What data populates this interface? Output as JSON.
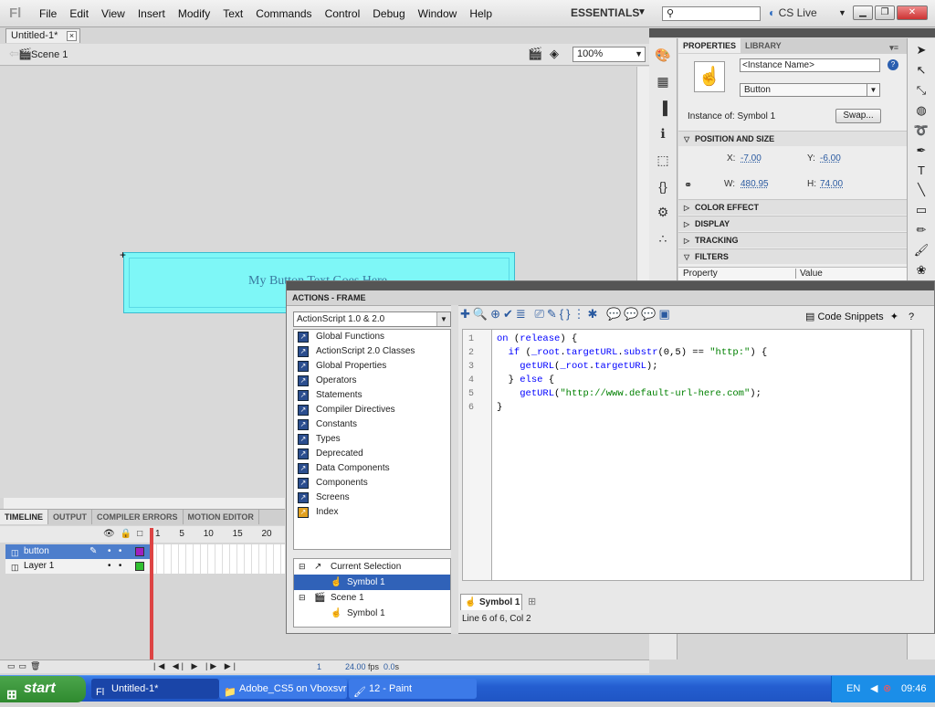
{
  "app": {
    "logo": "Fl",
    "menus": [
      "File",
      "Edit",
      "View",
      "Insert",
      "Modify",
      "Text",
      "Commands",
      "Control",
      "Debug",
      "Window",
      "Help"
    ],
    "workspace": "ESSENTIALS",
    "search_placeholder": "",
    "cslive": "CS Live"
  },
  "document": {
    "tab": "Untitled-1*",
    "scene": "Scene 1",
    "zoom": "100%"
  },
  "stage": {
    "button_text": "My Button Text Goes Here"
  },
  "timeline": {
    "tabs": [
      "TIMELINE",
      "OUTPUT",
      "COMPILER ERRORS",
      "MOTION EDITOR"
    ],
    "frame_numbers": [
      "1",
      "5",
      "10",
      "15",
      "20"
    ],
    "layers": [
      {
        "name": "button",
        "color": "#a020c0"
      },
      {
        "name": "Layer 1",
        "color": "#30c030"
      }
    ],
    "current_frame": "1",
    "fps": "24.00",
    "fps_unit": "fps",
    "seconds": "0.0",
    "seconds_unit": "s"
  },
  "properties": {
    "tabs": [
      "PROPERTIES",
      "LIBRARY"
    ],
    "instance_name_placeholder": "<Instance Name>",
    "symbol_type": "Button",
    "instance_of": "Instance of:  Symbol 1",
    "swap": "Swap...",
    "sections": {
      "position": "POSITION AND SIZE",
      "color": "COLOR EFFECT",
      "display": "DISPLAY",
      "tracking": "TRACKING",
      "filters": "FILTERS"
    },
    "x_label": "X:",
    "x": "-7.00",
    "y_label": "Y:",
    "y": "-6.00",
    "w_label": "W:",
    "w": "480.95",
    "h_label": "H:",
    "h": "74.00",
    "filter_cols": [
      "Property",
      "Value"
    ]
  },
  "actions": {
    "title": "ACTIONS - FRAME",
    "as_version": "ActionScript 1.0 & 2.0",
    "tree": [
      {
        "label": "Global Functions"
      },
      {
        "label": "ActionScript 2.0 Classes"
      },
      {
        "label": "Global Properties"
      },
      {
        "label": "Operators"
      },
      {
        "label": "Statements"
      },
      {
        "label": "Compiler Directives"
      },
      {
        "label": "Constants"
      },
      {
        "label": "Types"
      },
      {
        "label": "Deprecated"
      },
      {
        "label": "Data Components"
      },
      {
        "label": "Components"
      },
      {
        "label": "Screens"
      },
      {
        "label": "Index"
      }
    ],
    "selection_tree": {
      "current_selection": "Current Selection",
      "symbol1": "Symbol 1",
      "scene1": "Scene 1",
      "scene_symbol1": "Symbol 1"
    },
    "code_snippets": "Code Snippets",
    "code_lines": [
      "on (release) {",
      "  if (_root.targetURL.substr(0,5) == \"http:\") {",
      "    getURL(_root.targetURL);",
      "  } else {",
      "    getURL(\"http://www.default-url-here.com\");",
      "}"
    ],
    "line_numbers": [
      "1",
      "2",
      "3",
      "4",
      "5",
      "6"
    ],
    "symbol_tab": "Symbol 1",
    "status": "Line 6 of 6, Col 2"
  },
  "taskbar": {
    "start": "start",
    "tasks": [
      "Untitled-1*",
      "Adobe_CS5 on Vboxsvr",
      "12 - Paint"
    ],
    "lang": "EN",
    "time": "09:46"
  }
}
